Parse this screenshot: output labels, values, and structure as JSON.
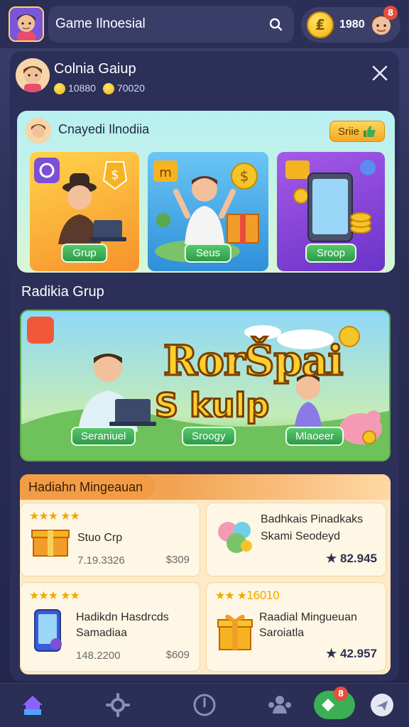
{
  "header": {
    "search_text": "Game Ilnoesial",
    "coin_symbol": "₤",
    "coin_value": "1980",
    "notification_count": "8"
  },
  "panel": {
    "title": "Colnia Gaiup",
    "stat_1": "10880",
    "stat_2": "70020"
  },
  "featured": {
    "title": "Cnayedi Ilnodiia",
    "button_label": "Sriie",
    "tiles": [
      {
        "label": "Grup"
      },
      {
        "label": "Seus"
      },
      {
        "label": "Sroop"
      }
    ]
  },
  "section": {
    "title": "Radikia Grup"
  },
  "banner": {
    "logo_line1": "RorŠpai",
    "logo_line2": "S kulp",
    "buttons": [
      "Seraniuel",
      "Sroogy",
      "Mlaoeer"
    ]
  },
  "rewards": {
    "title": "Hadiahn Mingeauan",
    "cards": [
      {
        "stars": "★★★ ★★",
        "title": "Stuo Crp",
        "price": "7.19.3326",
        "amount": "$309"
      },
      {
        "stars": "",
        "title": "Badhkais Pinadkaks",
        "subtitle": "Skami Seodeyd",
        "rating": "★ 82.945"
      },
      {
        "stars": "★★★ ★★",
        "title": "Hadikdn Hasdrcds",
        "subtitle": "Samadiaa",
        "price": "148.2200",
        "amount": "$609"
      },
      {
        "stars": "★★ ★16010",
        "title": "Raadial Mingueuan",
        "subtitle": "Saroiatla",
        "rating": "★ 42.957"
      }
    ]
  },
  "bottomnav": {
    "badge": "8"
  },
  "colors": {
    "background": "#2a2d52",
    "accent_green": "#3aaf55",
    "accent_gold": "#f5b321"
  }
}
